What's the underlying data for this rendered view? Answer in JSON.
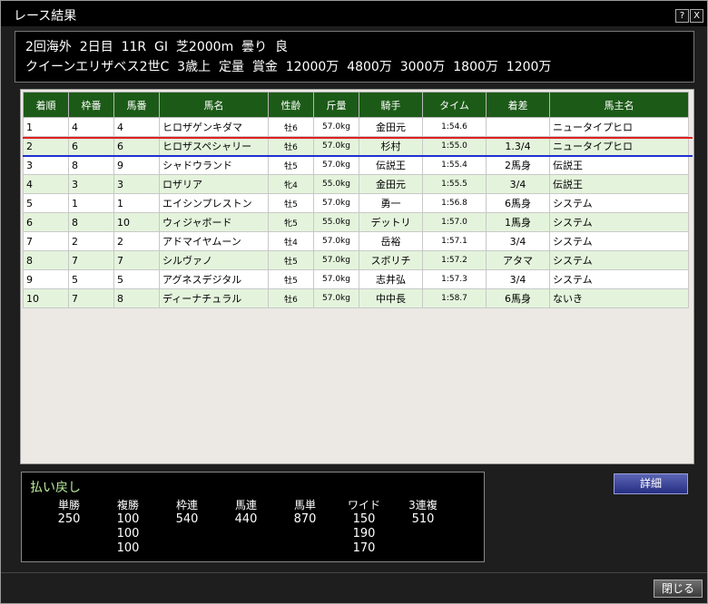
{
  "window": {
    "title": "レース結果",
    "help": "?",
    "close": "X"
  },
  "race": {
    "line1": "2回海外  2日目  11R  GⅠ  芝2000m  曇り  良",
    "line2": "クイーンエリザベス2世C  3歳上  定量  賞金  12000万  4800万  3000万  1800万  1200万"
  },
  "table": {
    "headers": [
      "着順",
      "枠番",
      "馬番",
      "馬名",
      "性齢",
      "斤量",
      "騎手",
      "タイム",
      "着差",
      "馬主名"
    ],
    "rows": [
      [
        "1",
        "4",
        "4",
        "ヒロザゲンキダマ",
        "牡6",
        "57.0kg",
        "金田元",
        "1:54.6",
        "",
        "ニュータイプヒロ"
      ],
      [
        "2",
        "6",
        "6",
        "ヒロザスペシャリー",
        "牡6",
        "57.0kg",
        "杉村",
        "1:55.0",
        "1.3/4",
        "ニュータイプヒロ"
      ],
      [
        "3",
        "8",
        "9",
        "シャドウランド",
        "牡5",
        "57.0kg",
        "伝説王",
        "1:55.4",
        "2馬身",
        "伝説王"
      ],
      [
        "4",
        "3",
        "3",
        "ロザリア",
        "牝4",
        "55.0kg",
        "金田元",
        "1:55.5",
        "3/4",
        "伝説王"
      ],
      [
        "5",
        "1",
        "1",
        "エイシンプレストン",
        "牡5",
        "57.0kg",
        "勇一",
        "1:56.8",
        "6馬身",
        "システム"
      ],
      [
        "6",
        "8",
        "10",
        "ウィジャボード",
        "牝5",
        "55.0kg",
        "デットリ",
        "1:57.0",
        "1馬身",
        "システム"
      ],
      [
        "7",
        "2",
        "2",
        "アドマイヤムーン",
        "牡4",
        "57.0kg",
        "岳裕",
        "1:57.1",
        "3/4",
        "システム"
      ],
      [
        "8",
        "7",
        "7",
        "シルヴァノ",
        "牡5",
        "57.0kg",
        "スボリチ",
        "1:57.2",
        "アタマ",
        "システム"
      ],
      [
        "9",
        "5",
        "5",
        "アグネスデジタル",
        "牡5",
        "57.0kg",
        "志井弘",
        "1:57.3",
        "3/4",
        "システム"
      ],
      [
        "10",
        "7",
        "8",
        "ディーナチュラル",
        "牡6",
        "57.0kg",
        "中中長",
        "1:58.7",
        "6馬身",
        "ないき"
      ]
    ]
  },
  "payout": {
    "title": "払い戻し",
    "columns": [
      {
        "label": "単勝",
        "values": [
          "250"
        ]
      },
      {
        "label": "複勝",
        "values": [
          "100",
          "100",
          "100"
        ]
      },
      {
        "label": "枠連",
        "values": [
          "540"
        ]
      },
      {
        "label": "馬連",
        "values": [
          "440"
        ]
      },
      {
        "label": "馬単",
        "values": [
          "870"
        ]
      },
      {
        "label": "ワイド",
        "values": [
          "150",
          "190",
          "170"
        ]
      },
      {
        "label": "3連複",
        "values": [
          "510"
        ]
      }
    ]
  },
  "buttons": {
    "detail": "詳細",
    "close": "閉じる"
  },
  "colors": {
    "header_green": "#1c5b17",
    "row_alt": "#e4f4dc",
    "winner_line": "#e02020",
    "second_line": "#2030d0",
    "payout_title": "#b9ea9c"
  }
}
